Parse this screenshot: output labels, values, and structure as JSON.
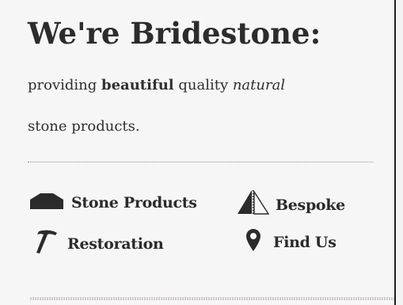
{
  "hero": {
    "headline": "We're Bridestone:",
    "tagline_prefix": "providing ",
    "tagline_bold": "beautiful",
    "tagline_mid": " quality ",
    "tagline_italic": "natural",
    "tagline_line2": "stone products."
  },
  "nav": [
    {
      "label": "Stone Products",
      "icon": "stone-slab-icon"
    },
    {
      "label": "Bespoke",
      "icon": "mast-sail-icon"
    },
    {
      "label": "Restoration",
      "icon": "hammer-icon"
    },
    {
      "label": "Find Us",
      "icon": "map-pin-icon"
    }
  ],
  "colors": {
    "background": "#f6f6f6",
    "text": "#2f2f2f",
    "divider": "#8e8e8e",
    "accent_rule": "#d8c9c9"
  }
}
